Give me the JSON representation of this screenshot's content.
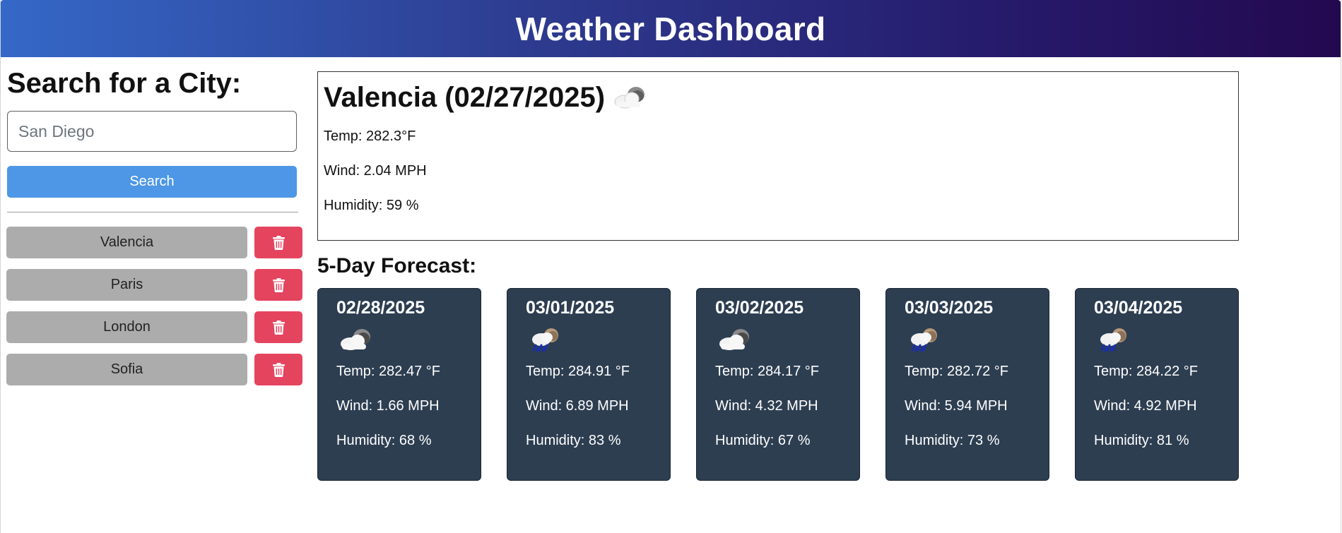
{
  "header": {
    "title": "Weather Dashboard"
  },
  "search": {
    "heading": "Search for a City:",
    "placeholder": "San Diego",
    "button_label": "Search"
  },
  "history": [
    {
      "city": "Valencia",
      "delete_icon": "trash-icon"
    },
    {
      "city": "Paris",
      "delete_icon": "trash-icon"
    },
    {
      "city": "London",
      "delete_icon": "trash-icon"
    },
    {
      "city": "Sofia",
      "delete_icon": "trash-icon"
    }
  ],
  "current": {
    "title": "Valencia (02/27/2025)",
    "icon": "cloud-sun-icon",
    "temp": "Temp: 282.3°F",
    "wind": "Wind: 2.04 MPH",
    "humidity": "Humidity: 59 %"
  },
  "forecast": {
    "heading": "5-Day Forecast:",
    "days": [
      {
        "date": "02/28/2025",
        "icon": "cloudy-night-icon",
        "temp": "Temp: 282.47 °F",
        "wind": "Wind: 1.66 MPH",
        "humidity": "Humidity: 68 %"
      },
      {
        "date": "03/01/2025",
        "icon": "rain-icon",
        "temp": "Temp: 284.91 °F",
        "wind": "Wind: 6.89 MPH",
        "humidity": "Humidity: 83 %"
      },
      {
        "date": "03/02/2025",
        "icon": "cloudy-night-icon",
        "temp": "Temp: 284.17 °F",
        "wind": "Wind: 4.32 MPH",
        "humidity": "Humidity: 67 %"
      },
      {
        "date": "03/03/2025",
        "icon": "rain-icon",
        "temp": "Temp: 282.72 °F",
        "wind": "Wind: 5.94 MPH",
        "humidity": "Humidity: 73 %"
      },
      {
        "date": "03/04/2025",
        "icon": "rain-icon",
        "temp": "Temp: 284.22 °F",
        "wind": "Wind: 4.92 MPH",
        "humidity": "Humidity: 81 %"
      }
    ]
  },
  "colors": {
    "header_start": "#3568c7",
    "header_end": "#23094f",
    "search_button": "#4d97e6",
    "city_button": "#acacac",
    "delete_button": "#e5445f",
    "card_bg": "#2d3e51"
  }
}
